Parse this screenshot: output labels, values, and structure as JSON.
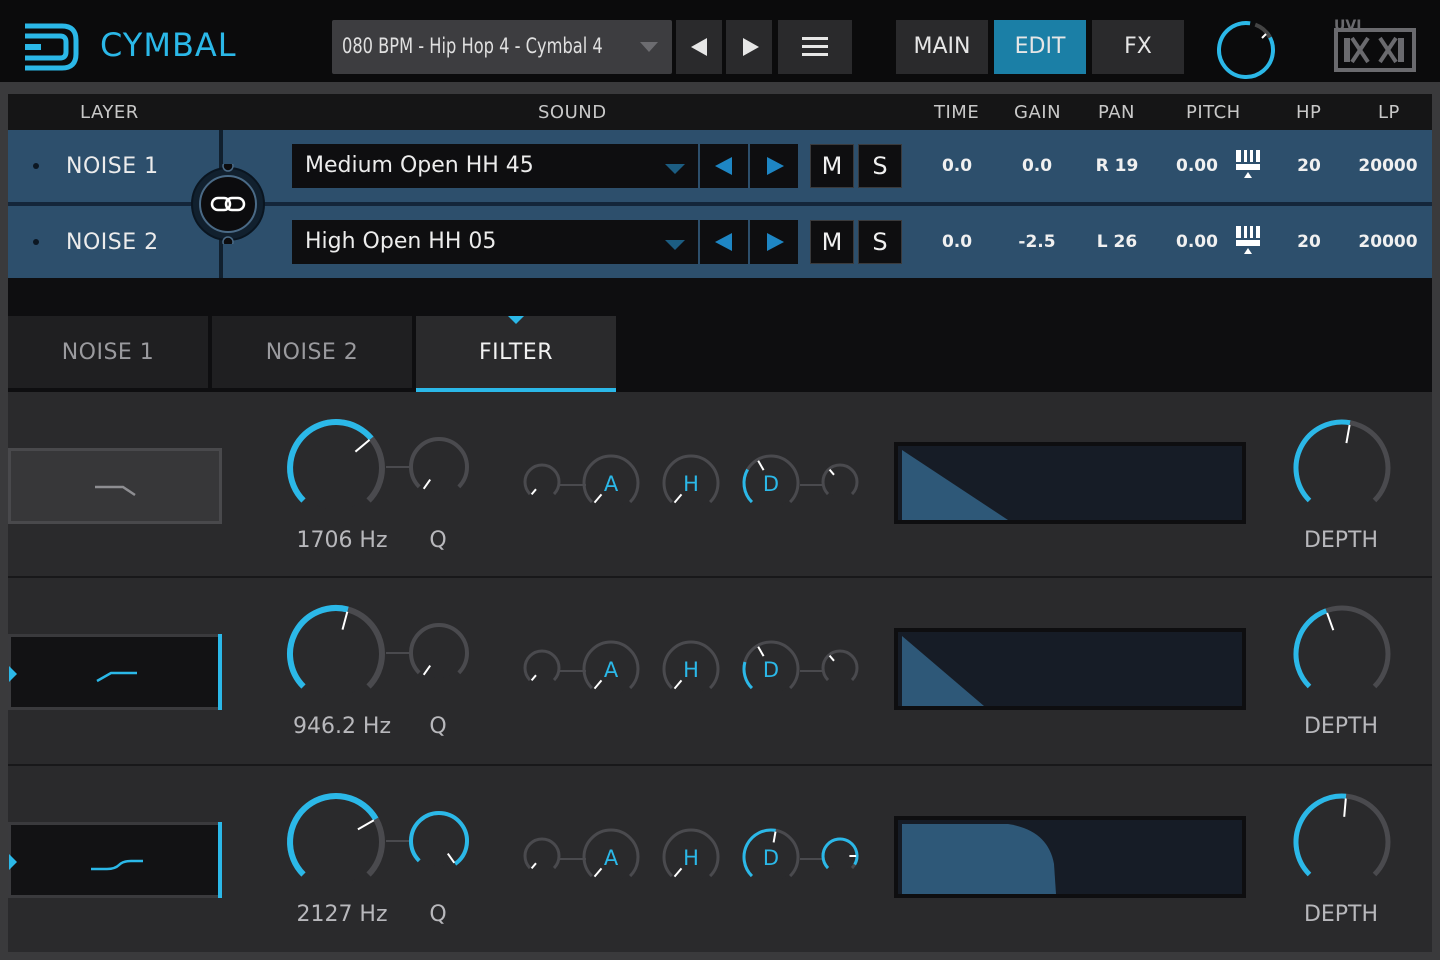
{
  "header": {
    "app_title": "CYMBAL",
    "preset_name": "080 BPM - Hip Hop 4 - Cymbal 4",
    "nav": {
      "main": "MAIN",
      "edit": "EDIT",
      "fx": "FX",
      "active": "EDIT"
    },
    "brand": "UVI"
  },
  "layers": {
    "columns": {
      "layer": "LAYER",
      "sound": "SOUND",
      "time": "TIME",
      "gain": "GAIN",
      "pan": "PAN",
      "pitch": "PITCH",
      "hp": "HP",
      "lp": "LP"
    },
    "rows": [
      {
        "name": "NOISE 1",
        "sound": "Medium Open HH 45",
        "mute": "M",
        "solo": "S",
        "time": "0.0",
        "gain": "0.0",
        "pan": "R 19",
        "pitch": "0.00",
        "hp": "20",
        "lp": "20000"
      },
      {
        "name": "NOISE 2",
        "sound": "High Open HH 05",
        "mute": "M",
        "solo": "S",
        "time": "0.0",
        "gain": "-2.5",
        "pan": "L 26",
        "pitch": "0.00",
        "hp": "20",
        "lp": "20000"
      }
    ]
  },
  "tabs": [
    {
      "label": "NOISE 1",
      "active": false
    },
    {
      "label": "NOISE 2",
      "active": false
    },
    {
      "label": "FILTER",
      "active": true
    }
  ],
  "filters": [
    {
      "type": "lowpass",
      "enabled": false,
      "freq_label": "1706 Hz",
      "q_label": "Q",
      "depth_label": "DEPTH",
      "env": {
        "a": "A",
        "h": "H",
        "d": "D"
      }
    },
    {
      "type": "highpass",
      "enabled": true,
      "freq_label": "946.2 Hz",
      "q_label": "Q",
      "depth_label": "DEPTH",
      "env": {
        "a": "A",
        "h": "H",
        "d": "D"
      }
    },
    {
      "type": "highpass-soft",
      "enabled": true,
      "freq_label": "2127 Hz",
      "q_label": "Q",
      "depth_label": "DEPTH",
      "env": {
        "a": "A",
        "h": "H",
        "d": "D"
      }
    }
  ],
  "colors": {
    "accent": "#2bb8e8",
    "row_bg": "#2d4f6c",
    "active_nav": "#1b7fa6",
    "panel": "#2a2a2c"
  }
}
